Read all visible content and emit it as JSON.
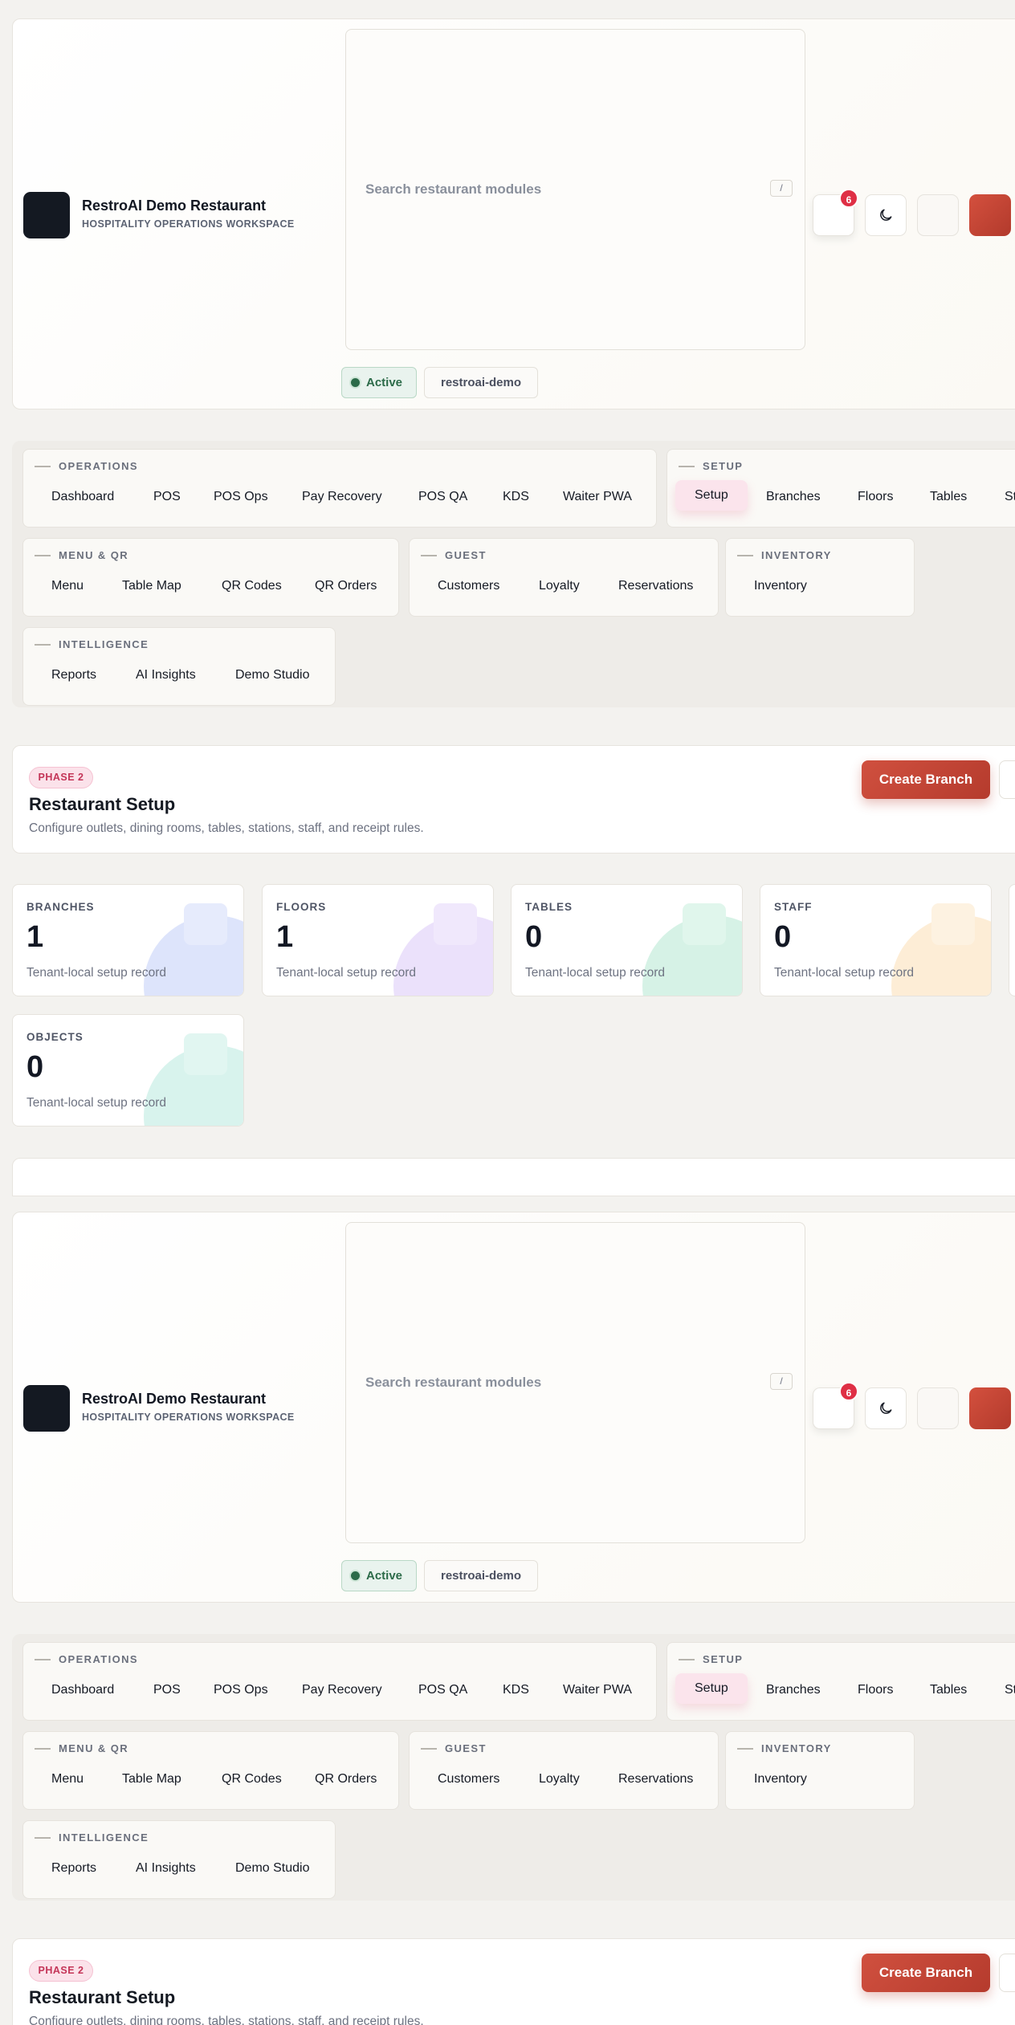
{
  "header": {
    "brand_name": "RestroAI Demo Restaurant",
    "brand_sub": "HOSPITALITY OPERATIONS WORKSPACE",
    "search_placeholder": "Search restaurant modules",
    "search_shortcut": "/",
    "notification_count": "6",
    "status_label": "Active",
    "tenant_slug": "restroai-demo"
  },
  "nav": {
    "operations": {
      "title": "OPERATIONS",
      "items": [
        "Dashboard",
        "POS",
        "POS Ops",
        "Pay Recovery",
        "POS QA",
        "KDS",
        "Waiter PWA"
      ]
    },
    "setup": {
      "title": "SETUP",
      "items": [
        "Setup",
        "Branches",
        "Floors",
        "Tables",
        "St"
      ]
    },
    "menu_qr": {
      "title": "MENU & QR",
      "items": [
        "Menu",
        "Table Map",
        "QR Codes",
        "QR Orders"
      ]
    },
    "guest": {
      "title": "GUEST",
      "items": [
        "Customers",
        "Loyalty",
        "Reservations"
      ]
    },
    "inventory": {
      "title": "INVENTORY",
      "items": [
        "Inventory"
      ]
    },
    "intelligence": {
      "title": "INTELLIGENCE",
      "items": [
        "Reports",
        "AI Insights",
        "Demo Studio"
      ]
    }
  },
  "page": {
    "phase": "PHASE 2",
    "title": "Restaurant Setup",
    "subtitle": "Configure outlets, dining rooms, tables, stations, staff, and receipt rules.",
    "create_label": "Create Branch"
  },
  "stats": [
    {
      "label": "BRANCHES",
      "value": "1",
      "note": "Tenant-local setup record",
      "color": "#dde4fb"
    },
    {
      "label": "FLOORS",
      "value": "1",
      "note": "Tenant-local setup record",
      "color": "#ebe1fb"
    },
    {
      "label": "TABLES",
      "value": "0",
      "note": "Tenant-local setup record",
      "color": "#d6f2e6"
    },
    {
      "label": "STAFF",
      "value": "0",
      "note": "Tenant-local setup record",
      "color": "#fdedd6"
    },
    {
      "label": "OBJECTS",
      "value": "0",
      "note": "Tenant-local setup record",
      "color": "#d8f3ed"
    }
  ],
  "colors": {
    "accent_red": "#c2432f",
    "selected_nav": "#fbe4ec",
    "active_green": "#2c6b49",
    "badge_red": "#df2f45"
  }
}
